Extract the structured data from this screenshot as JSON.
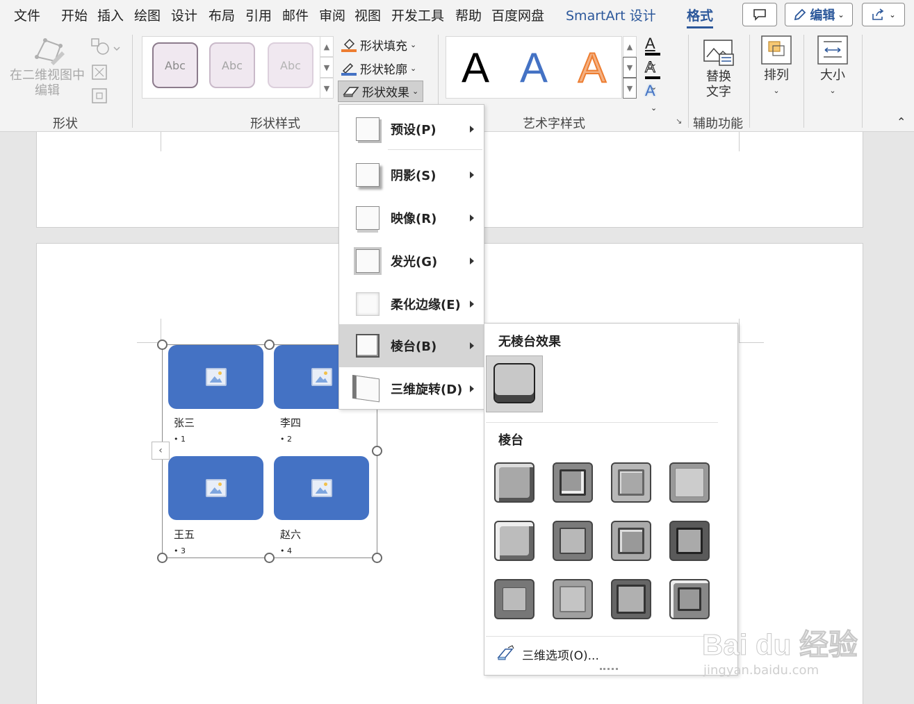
{
  "menubar": {
    "tabs": [
      "文件",
      "开始",
      "插入",
      "绘图",
      "设计",
      "布局",
      "引用",
      "邮件",
      "审阅",
      "视图",
      "开发工具",
      "帮助",
      "百度网盘"
    ],
    "smartart_tab": "SmartArt 设计",
    "active_tab": "格式",
    "edit_label": "编辑"
  },
  "ribbon": {
    "shape_group": {
      "edit_2d_label": "在二维视图中编辑",
      "label": "形状"
    },
    "shape_styles": {
      "gallery": [
        "Abc",
        "Abc",
        "Abc"
      ],
      "fill": "形状填充",
      "outline": "形状轮廓",
      "effects": "形状效果",
      "label": "形状样式"
    },
    "wordart": {
      "letters": [
        "A",
        "A",
        "A"
      ],
      "label": "艺术字样式",
      "text_fill_letter": "A",
      "text_outline_letter": "A",
      "text_effect_letter": "A"
    },
    "accessibility": {
      "alt_text": "替换\n文字",
      "label": "辅助功能"
    },
    "arrange": "排列",
    "size": "大小"
  },
  "smartart": {
    "items": [
      {
        "name": "张三",
        "bullet": "• 1"
      },
      {
        "name": "李四",
        "bullet": "• 2"
      },
      {
        "name": "王五",
        "bullet": "• 3"
      },
      {
        "name": "赵六",
        "bullet": "• 4"
      }
    ]
  },
  "effect_menu": {
    "items": [
      {
        "label": "预设(P)"
      },
      {
        "label": "阴影(S)"
      },
      {
        "label": "映像(R)"
      },
      {
        "label": "发光(G)"
      },
      {
        "label": "柔化边缘(E)"
      },
      {
        "label": "棱台(B)",
        "highlighted": true
      },
      {
        "label": "三维旋转(D)"
      }
    ]
  },
  "bevel_menu": {
    "no_bevel_heading": "无棱台效果",
    "bevel_heading": "棱台",
    "options_label": "三维选项(O)...",
    "presets_count": 12
  },
  "watermark": {
    "brand": "Bai du 经验",
    "url": "jingyan.baidu.com"
  },
  "colors": {
    "accent": "#2b579a",
    "tile": "#4472c4",
    "highlight": "#d5d5d5"
  }
}
